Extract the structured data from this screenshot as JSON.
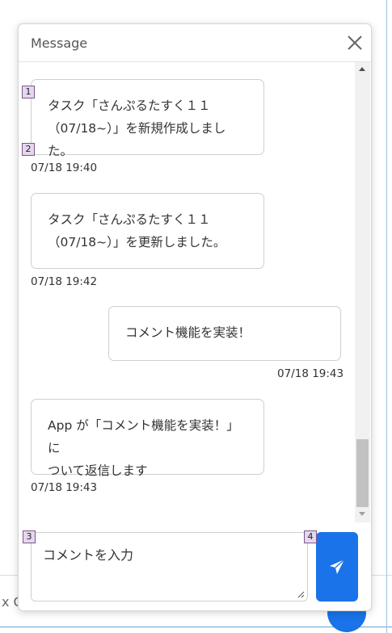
{
  "dialog": {
    "title": "Message"
  },
  "messages": [
    {
      "text_lines": [
        "タスク「さんぷるたすく１１",
        "（07/18~）」を新規作成しました。"
      ],
      "time": "07/18 19:40",
      "side": "left"
    },
    {
      "text_lines": [
        "タスク「さんぷるたすく１１",
        "（07/18~）」を更新しました。"
      ],
      "time": "07/18 19:42",
      "side": "left"
    },
    {
      "text_lines": [
        "コメント機能を実装！"
      ],
      "time": "07/18 19:43",
      "side": "right"
    },
    {
      "text_lines": [
        "App が「コメント機能を実装！」に",
        "ついて返信します"
      ],
      "time": "07/18 19:43",
      "side": "left"
    }
  ],
  "composer": {
    "placeholder": "コメントを入力"
  },
  "markers": [
    "1",
    "2",
    "3",
    "4"
  ],
  "background": {
    "partial_text": "x C"
  },
  "colors": {
    "accent": "#1a73e8",
    "marker_fill": "#e6d6ee"
  },
  "icons": {
    "close": "close-icon",
    "send": "send-icon"
  }
}
